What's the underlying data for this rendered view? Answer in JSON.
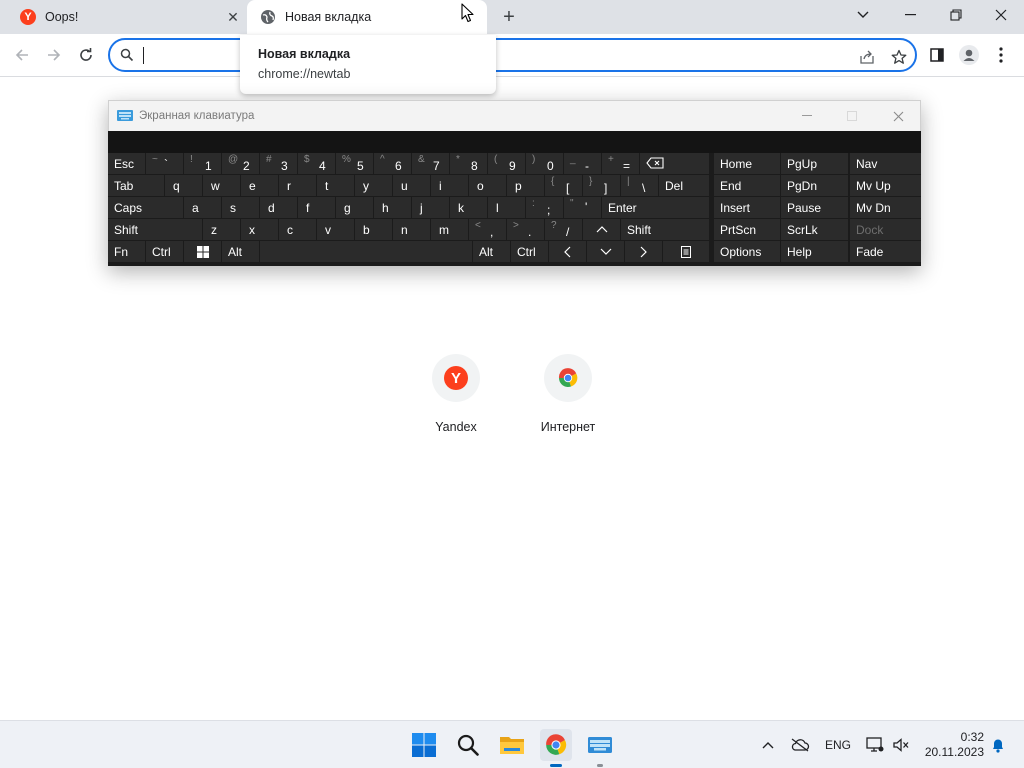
{
  "tabs": {
    "inactive": {
      "title": "Oops!",
      "favicon": "yandex-icon"
    },
    "active": {
      "title": "Новая вкладка",
      "favicon": "globe-icon"
    }
  },
  "hovercard": {
    "title": "Новая вкладка",
    "url": "chrome://newtab"
  },
  "omnibox": {
    "value": ""
  },
  "osk": {
    "title": "Экранная клавиатура",
    "keys": {
      "esc": "Esc",
      "tab": "Tab",
      "caps": "Caps",
      "shift_l": "Shift",
      "fn": "Fn",
      "ctrl_l": "Ctrl",
      "alt_l": "Alt",
      "alt_r": "Alt",
      "ctrl_r": "Ctrl",
      "del": "Del",
      "enter": "Enter",
      "shift_r": "Shift",
      "tilde_sub": "~",
      "tilde": "`",
      "d1_sub": "!",
      "d1": "1",
      "d2_sub": "@",
      "d2": "2",
      "d3_sub": "#",
      "d3": "3",
      "d4_sub": "$",
      "d4": "4",
      "d5_sub": "%",
      "d5": "5",
      "d6_sub": "^",
      "d6": "6",
      "d7_sub": "&",
      "d7": "7",
      "d8_sub": "*",
      "d8": "8",
      "d9_sub": "(",
      "d9": "9",
      "d0_sub": ")",
      "d0": "0",
      "minus_sub": "_",
      "minus": "-",
      "plus_sub": "+",
      "plus": "=",
      "q": "q",
      "w": "w",
      "e": "e",
      "r": "r",
      "t": "t",
      "y": "y",
      "u": "u",
      "i": "i",
      "o": "o",
      "p": "p",
      "lbr_sub": "{",
      "lbr": "[",
      "rbr_sub": "}",
      "rbr": "]",
      "bsl_sub": "|",
      "bsl": "\\",
      "a": "a",
      "s": "s",
      "d": "d",
      "f": "f",
      "g": "g",
      "h": "h",
      "j": "j",
      "k": "k",
      "l": "l",
      "semi_sub": ":",
      "semi": ";",
      "quote_sub": "\"",
      "quote": "'",
      "z": "z",
      "x": "x",
      "c": "c",
      "v": "v",
      "b": "b",
      "n": "n",
      "m": "m",
      "comma_sub": "<",
      "comma": ",",
      "dot_sub": ">",
      "dot": ".",
      "slash_sub": "?",
      "slash": "/",
      "home": "Home",
      "pgup": "PgUp",
      "nav": "Nav",
      "end": "End",
      "pgdn": "PgDn",
      "mvup": "Mv Up",
      "insert": "Insert",
      "pause": "Pause",
      "mvdn": "Mv Dn",
      "prtscn": "PrtScn",
      "scrlk": "ScrLk",
      "dock": "Dock",
      "options": "Options",
      "help": "Help",
      "fade": "Fade"
    }
  },
  "shortcuts": [
    {
      "label": "Yandex",
      "icon": "yandex-icon"
    },
    {
      "label": "Интернет",
      "icon": "chrome-icon"
    }
  ],
  "tray": {
    "lang": "ENG",
    "time": "0:32",
    "date": "20.11.2023"
  },
  "colors": {
    "accent": "#1a73e8",
    "yandex": "#fc3f1d",
    "osk_bg": "#1b1b1b",
    "osk_key": "#2b2b2b"
  }
}
